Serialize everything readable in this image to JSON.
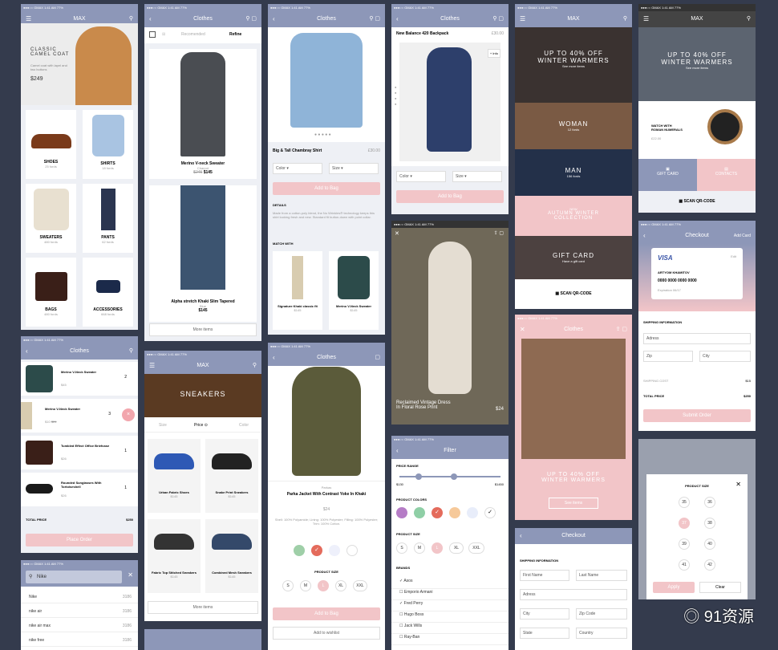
{
  "status": {
    "carrier": "●●●○○ GMAX",
    "time": "1:41 AM",
    "battery": "77%"
  },
  "max": "MAX",
  "clothes": "Clothes",
  "filter": "Filter",
  "checkout": "Checkout",
  "s1": {
    "hero_title": "CLASSIC\nCAMEL COAT",
    "hero_sub": "Camel coat with lapel and two buttons",
    "price": "$249",
    "cats": [
      {
        "n": "SHOES",
        "c": "25 fords"
      },
      {
        "n": "SHIRTS",
        "c": "18 fords"
      },
      {
        "n": "SWEATERS",
        "c": "480 fords"
      },
      {
        "n": "PANTS",
        "c": "62 fords"
      },
      {
        "n": "BAGS",
        "c": "480 fords"
      },
      {
        "n": "ACCESSORIES",
        "c": "668 fords"
      }
    ]
  },
  "s2": {
    "tab1": "Recomended",
    "tab2": "Refine",
    "p1": "Merino V-neck Sweater",
    "p1s": "Charpot",
    "p1old": "$245",
    "p1new": "$145",
    "p2": "Alpha stretch Khaki Slim Tapered",
    "p2s": "Blue",
    "p2p": "$145",
    "more": "More items"
  },
  "s3": {
    "title": "Big & Tall Chambray Shirt",
    "price": "£30.00",
    "color": "Color",
    "size": "Size",
    "add": "Add to Bag",
    "details": "DETAILS",
    "desc": "Made from a cotton-poly blend, the No Wrinkles® technology keeps this shirt looking fresh and new. Standard fit button-down with point collar.",
    "match": "MATCH WITH",
    "m1": "Signature Khaki classic fit",
    "m1p": "$145",
    "m2": "Merino V-Neck Sweater",
    "m2p": "$145"
  },
  "s4": {
    "title": "New Balance 420 Backpack",
    "price": "£30.00",
    "info": "+ Info",
    "color": "Color",
    "size": "Size",
    "add": "Add to Bag"
  },
  "s5": {
    "b1": "UP TO 40% OFF\nWINTER WARMERS",
    "b1s": "See more items",
    "woman": "WOMAN",
    "womans": "12 fords",
    "man": "MAN",
    "mans": "156 fords",
    "new": "NEW",
    "autumn": "AUTUMN WINTER\nCOLLECTION",
    "gift": "GIFT CARD",
    "gifts": "Have a gift card",
    "scan": "SCAN QR-CODE"
  },
  "s6": {
    "banner": "UP TO 40% OFF\nWINTER WARMERS",
    "bs": "See more items",
    "watch": "WATCH WITH\nROMAN NUMERALS",
    "wprice": "£22.00",
    "gift": "GIFT CARD",
    "contacts": "CONTACTS",
    "scan": "SCAN QR-CODE"
  },
  "s7": {
    "items": [
      {
        "n": "Merino V-Neck Sweater",
        "p": "$45",
        "q": "2"
      },
      {
        "n": "Merino V-Neck Sweater",
        "p": "$10",
        "p2": "$24",
        "q": "3"
      },
      {
        "n": "Tumbled Effect Office Briefcase",
        "p": "$26",
        "q": "1"
      },
      {
        "n": "Rounded Sunglasses With Tortoiseshell",
        "p": "$26",
        "q": "1"
      }
    ],
    "total": "TOTAL PRICE",
    "totalv": "$250",
    "place": "Place Order"
  },
  "s8": {
    "title": "SNEAKERS",
    "tabs": [
      "Size",
      "Price ⊙",
      "Color"
    ],
    "p": [
      {
        "n": "Urban Fabric Shoes",
        "p": "$145"
      },
      {
        "n": "Snake Print Sneakers",
        "p": "$145"
      },
      {
        "n": "Fabric Top Stitched Sneakers",
        "p": "$145"
      },
      {
        "n": "Combined Mesh Sneakers",
        "p": "$145"
      }
    ],
    "more": "More items"
  },
  "s9": {
    "brand": "Parkas",
    "title": "Parka Jacket With Contrast Yoke In Khaki",
    "price": "$24",
    "desc": "Shell: 100% Polyamide; Lining: 100% Polyester; Filling: 100% Polyester; Trim: 100% Cotton.",
    "size": "PRODUCT SIZE",
    "sizes": [
      "S",
      "M",
      "L",
      "XL",
      "XXL"
    ],
    "add": "Add to Bag",
    "wish": "Add to wishlist"
  },
  "s10": {
    "caption": "Reclaimed Vintage Dress\nIn Floral Rose Print",
    "price": "$24"
  },
  "s11": {
    "range": "PRICE RANGE",
    "min": "$130",
    "max": "$1450",
    "colors": "PRODUCT COLORS",
    "psize": "PRODUCT SIZE",
    "sizes": [
      "S",
      "M",
      "L",
      "XL",
      "XXL"
    ],
    "brands": "BRANDS",
    "blist": [
      "Asos",
      "Emporio Armani",
      "Fred Perry",
      "Hugo Boss",
      "Jack Wills",
      "Ray-Ban"
    ]
  },
  "s12": {
    "banner": "UP TO 40% OFF\nWINTER WARMERS",
    "see": "See items"
  },
  "s13": {
    "add": "Add Card",
    "visa": "VISA",
    "edit": "Edit",
    "name": "ARTYOM KHAMITOV",
    "num": "0000 0000 0000 0000",
    "exp": "Expiration 06/17",
    "ship": "SHIPPING INFORMATION",
    "addr": "Adress",
    "zip": "Zip",
    "city": "City",
    "cost": "SHIPPING COST",
    "costv": "$15",
    "total": "TOTAL PRICE",
    "totalv": "$250",
    "submit": "Submit Order"
  },
  "s14": {
    "ship": "SHIPPING INFORMATION",
    "fn": "First Name",
    "ln": "Last Name",
    "addr": "Adress",
    "city": "City",
    "zip": "Zip Code",
    "state": "State",
    "country": "Country"
  },
  "s15": {
    "title": "PRODUCT SIZE",
    "sizes": [
      "35",
      "36",
      "37",
      "38",
      "39",
      "40",
      "41",
      "42"
    ],
    "apply": "Apply",
    "clear": "Clear"
  },
  "s16": {
    "q": "Nike",
    "rows": [
      {
        "n": "Nike",
        "c": "3186"
      },
      {
        "n": "nike air",
        "c": "3186"
      },
      {
        "n": "nike air max",
        "c": "3186"
      },
      {
        "n": "nike free",
        "c": "3186"
      }
    ]
  },
  "watermark": "91资源"
}
